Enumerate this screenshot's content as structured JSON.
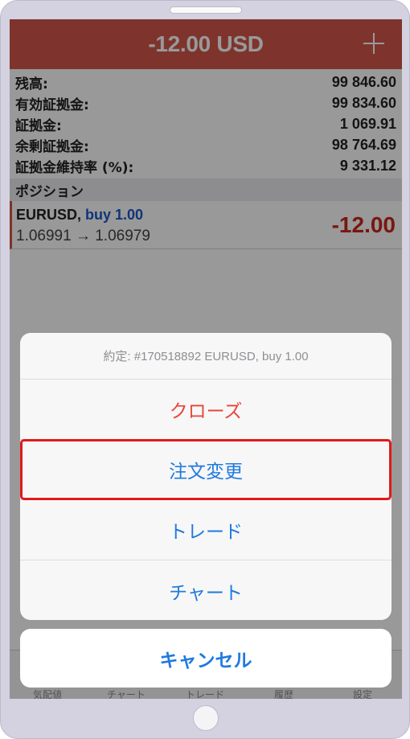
{
  "header": {
    "title": "-12.00 USD"
  },
  "summary": [
    {
      "label": "残高:",
      "value": "99 846.60"
    },
    {
      "label": "有効証拠金:",
      "value": "99 834.60"
    },
    {
      "label": "証拠金:",
      "value": "1 069.91"
    },
    {
      "label": "余剰証拠金:",
      "value": "98 764.69"
    },
    {
      "label": "証拠金維持率 (%):",
      "value": "9 331.12"
    }
  ],
  "positions": {
    "section_title": "ポジション",
    "items": [
      {
        "symbol": "EURUSD,",
        "side": "buy 1.00",
        "prices": "1.06991 → 1.06979",
        "profit": "-12.00"
      }
    ]
  },
  "tabs": [
    "気配値",
    "チャート",
    "トレード",
    "履歴",
    "設定"
  ],
  "action_sheet": {
    "title": "約定: #170518892 EURUSD, buy 1.00",
    "close": "クローズ",
    "modify": "注文変更",
    "trade": "トレード",
    "chart": "チャート",
    "cancel": "キャンセル"
  },
  "colors": {
    "header_bg": "#d2584a",
    "accent_blue": "#1f7ae0",
    "destructive_red": "#e9443a",
    "loss_red": "#c9271b",
    "highlight": "#e01a1a"
  }
}
